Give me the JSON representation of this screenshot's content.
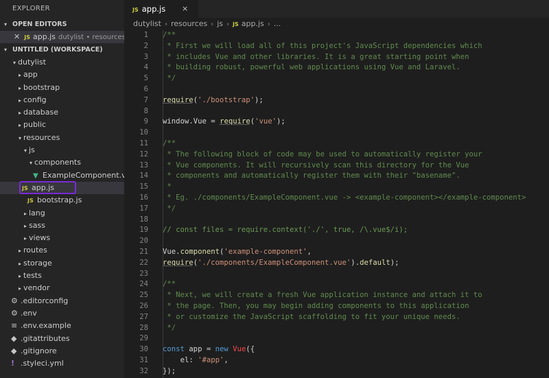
{
  "explorer": {
    "title": "EXPLORER",
    "open_editors_label": "OPEN EDITORS",
    "open_editor": {
      "icon": "JS",
      "name": "app.js",
      "hint": "dutylist • resources\\js"
    },
    "workspace_label": "UNTITLED (WORKSPACE)",
    "tree": [
      {
        "label": "dutylist",
        "type": "folder-open"
      },
      {
        "label": "app",
        "type": "folder"
      },
      {
        "label": "bootstrap",
        "type": "folder"
      },
      {
        "label": "config",
        "type": "folder"
      },
      {
        "label": "database",
        "type": "folder"
      },
      {
        "label": "public",
        "type": "folder"
      },
      {
        "label": "resources",
        "type": "folder-open"
      },
      {
        "label": "js",
        "type": "folder-open"
      },
      {
        "label": "components",
        "type": "folder-open"
      },
      {
        "label": "ExampleComponent.vue",
        "type": "vue"
      },
      {
        "label": "app.js",
        "type": "js"
      },
      {
        "label": "bootstrap.js",
        "type": "js"
      },
      {
        "label": "lang",
        "type": "folder"
      },
      {
        "label": "sass",
        "type": "folder"
      },
      {
        "label": "views",
        "type": "folder"
      },
      {
        "label": "routes",
        "type": "folder"
      },
      {
        "label": "storage",
        "type": "folder"
      },
      {
        "label": "tests",
        "type": "folder"
      },
      {
        "label": "vendor",
        "type": "folder"
      },
      {
        "label": ".editorconfig",
        "type": "gear"
      },
      {
        "label": ".env",
        "type": "gear"
      },
      {
        "label": ".env.example",
        "type": "lines"
      },
      {
        "label": ".gitattributes",
        "type": "git"
      },
      {
        "label": ".gitignore",
        "type": "git"
      },
      {
        "label": ".styleci.yml",
        "type": "bang"
      }
    ]
  },
  "tab": {
    "icon": "JS",
    "label": "app.js",
    "close": "×"
  },
  "breadcrumb": {
    "items": [
      "dutylist",
      "resources",
      "js",
      "app.js",
      "..."
    ],
    "file_icon": "JS"
  },
  "editor": {
    "lines": [
      {
        "n": "1",
        "t": "/**"
      },
      {
        "n": "2",
        "t": " * First we will load all of this project's JavaScript dependencies which"
      },
      {
        "n": "3",
        "t": " * includes Vue and other libraries. It is a great starting point when"
      },
      {
        "n": "4",
        "t": " * building robust, powerful web applications using Vue and Laravel."
      },
      {
        "n": "5",
        "t": " */"
      },
      {
        "n": "6",
        "t": ""
      },
      {
        "n": "7",
        "t": "require('./bootstrap');"
      },
      {
        "n": "8",
        "t": ""
      },
      {
        "n": "9",
        "t": "window.Vue = require('vue');"
      },
      {
        "n": "10",
        "t": ""
      },
      {
        "n": "11",
        "t": "/**"
      },
      {
        "n": "12",
        "t": " * The following block of code may be used to automatically register your"
      },
      {
        "n": "13",
        "t": " * Vue components. It will recursively scan this directory for the Vue"
      },
      {
        "n": "14",
        "t": " * components and automatically register them with their \"basename\"."
      },
      {
        "n": "15",
        "t": " *"
      },
      {
        "n": "16",
        "t": " * Eg. ./components/ExampleComponent.vue -> <example-component></example-component>"
      },
      {
        "n": "17",
        "t": " */"
      },
      {
        "n": "18",
        "t": ""
      },
      {
        "n": "19",
        "t": "// const files = require.context('./', true, /\\.vue$/i);"
      },
      {
        "n": "20",
        "t": ""
      },
      {
        "n": "21",
        "t": "Vue.component('example-component',"
      },
      {
        "n": "22",
        "t": "require('./components/ExampleComponent.vue').default);"
      },
      {
        "n": "23",
        "t": ""
      },
      {
        "n": "24",
        "t": "/**"
      },
      {
        "n": "25",
        "t": " * Next, we will create a fresh Vue application instance and attach it to"
      },
      {
        "n": "26",
        "t": " * the page. Then, you may begin adding components to this application"
      },
      {
        "n": "27",
        "t": " * or customize the JavaScript scaffolding to fit your unique needs."
      },
      {
        "n": "28",
        "t": " */"
      },
      {
        "n": "29",
        "t": ""
      },
      {
        "n": "30",
        "t": "const app = new Vue({"
      },
      {
        "n": "31",
        "t": "    el: '#app',"
      },
      {
        "n": "32",
        "t": "});"
      }
    ]
  },
  "colors": {
    "highlight_box": "#7a2ad8",
    "js_icon": "#cbcb41",
    "vue_icon": "#41b883"
  }
}
